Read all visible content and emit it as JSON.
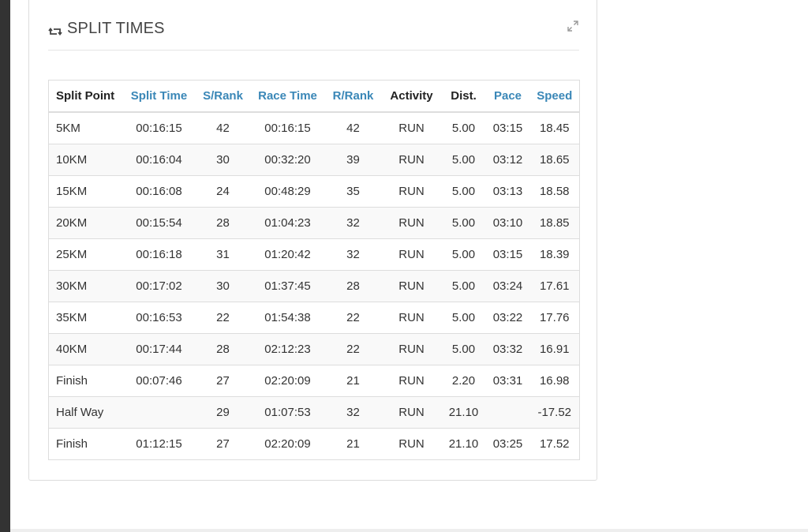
{
  "panel": {
    "title": "SPLIT TIMES",
    "title_icon": "retweet-icon",
    "expand_icon": "expand-icon"
  },
  "table": {
    "columns": [
      {
        "label": "Split Point",
        "sortable": false
      },
      {
        "label": "Split Time",
        "sortable": true
      },
      {
        "label": "S/Rank",
        "sortable": true
      },
      {
        "label": "Race Time",
        "sortable": true
      },
      {
        "label": "R/Rank",
        "sortable": true
      },
      {
        "label": "Activity",
        "sortable": false
      },
      {
        "label": "Dist.",
        "sortable": false
      },
      {
        "label": "Pace",
        "sortable": true
      },
      {
        "label": "Speed",
        "sortable": true
      }
    ],
    "rows": [
      [
        "5KM",
        "00:16:15",
        "42",
        "00:16:15",
        "42",
        "RUN",
        "5.00",
        "03:15",
        "18.45"
      ],
      [
        "10KM",
        "00:16:04",
        "30",
        "00:32:20",
        "39",
        "RUN",
        "5.00",
        "03:12",
        "18.65"
      ],
      [
        "15KM",
        "00:16:08",
        "24",
        "00:48:29",
        "35",
        "RUN",
        "5.00",
        "03:13",
        "18.58"
      ],
      [
        "20KM",
        "00:15:54",
        "28",
        "01:04:23",
        "32",
        "RUN",
        "5.00",
        "03:10",
        "18.85"
      ],
      [
        "25KM",
        "00:16:18",
        "31",
        "01:20:42",
        "32",
        "RUN",
        "5.00",
        "03:15",
        "18.39"
      ],
      [
        "30KM",
        "00:17:02",
        "30",
        "01:37:45",
        "28",
        "RUN",
        "5.00",
        "03:24",
        "17.61"
      ],
      [
        "35KM",
        "00:16:53",
        "22",
        "01:54:38",
        "22",
        "RUN",
        "5.00",
        "03:22",
        "17.76"
      ],
      [
        "40KM",
        "00:17:44",
        "28",
        "02:12:23",
        "22",
        "RUN",
        "5.00",
        "03:32",
        "16.91"
      ],
      [
        "Finish",
        "00:07:46",
        "27",
        "02:20:09",
        "21",
        "RUN",
        "2.20",
        "03:31",
        "16.98"
      ],
      [
        "Half Way",
        "",
        "29",
        "01:07:53",
        "32",
        "RUN",
        "21.10",
        "",
        "-17.52"
      ],
      [
        "Finish",
        "01:12:15",
        "27",
        "02:20:09",
        "21",
        "RUN",
        "21.10",
        "03:25",
        "17.52"
      ]
    ]
  },
  "colors": {
    "link": "#3a87b7",
    "sidebar": "#333333",
    "border": "#dddddd"
  }
}
